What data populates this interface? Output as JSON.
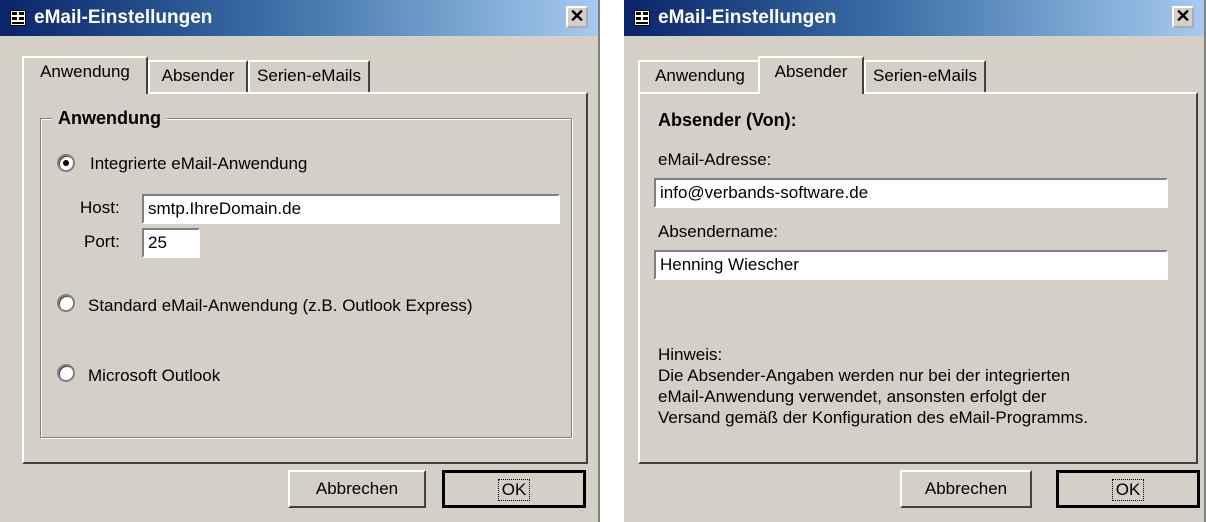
{
  "left_window": {
    "title": "eMail-Einstellungen",
    "close_glyph": "✕",
    "tabs": [
      {
        "label": "Anwendung",
        "active": true
      },
      {
        "label": "Absender",
        "active": false
      },
      {
        "label": "Serien-eMails",
        "active": false
      }
    ],
    "group_label": "Anwendung",
    "options": [
      {
        "label": "Integrierte eMail-Anwendung",
        "checked": true
      },
      {
        "label": "Standard eMail-Anwendung (z.B. Outlook Express)",
        "checked": false
      },
      {
        "label": "Microsoft Outlook",
        "checked": false
      }
    ],
    "host_label": "Host:",
    "host_value": "smtp.IhreDomain.de",
    "port_label": "Port:",
    "port_value": "25",
    "cancel_label": "Abbrechen",
    "ok_label": "OK"
  },
  "right_window": {
    "title": "eMail-Einstellungen",
    "close_glyph": "✕",
    "tabs": [
      {
        "label": "Anwendung",
        "active": false
      },
      {
        "label": "Absender",
        "active": true
      },
      {
        "label": "Serien-eMails",
        "active": false
      }
    ],
    "section_heading": "Absender (Von):",
    "email_label": "eMail-Adresse:",
    "email_value": "info@verbands-software.de",
    "name_label": "Absendername:",
    "name_value": "Henning Wiescher",
    "note_heading": "Hinweis:",
    "note_lines": [
      "Die Absender-Angaben werden nur bei der integrierten",
      "eMail-Anwendung verwendet, ansonsten erfolgt der",
      "Versand gemäß der Konfiguration des eMail-Programms."
    ],
    "cancel_label": "Abbrechen",
    "ok_label": "OK"
  },
  "colors": {
    "dialog_bg": "#d4d0c8",
    "title_start": "#0a246a",
    "title_end": "#a6caf0"
  },
  "icons": {
    "title_icon": "form-icon",
    "close": "close-icon"
  }
}
